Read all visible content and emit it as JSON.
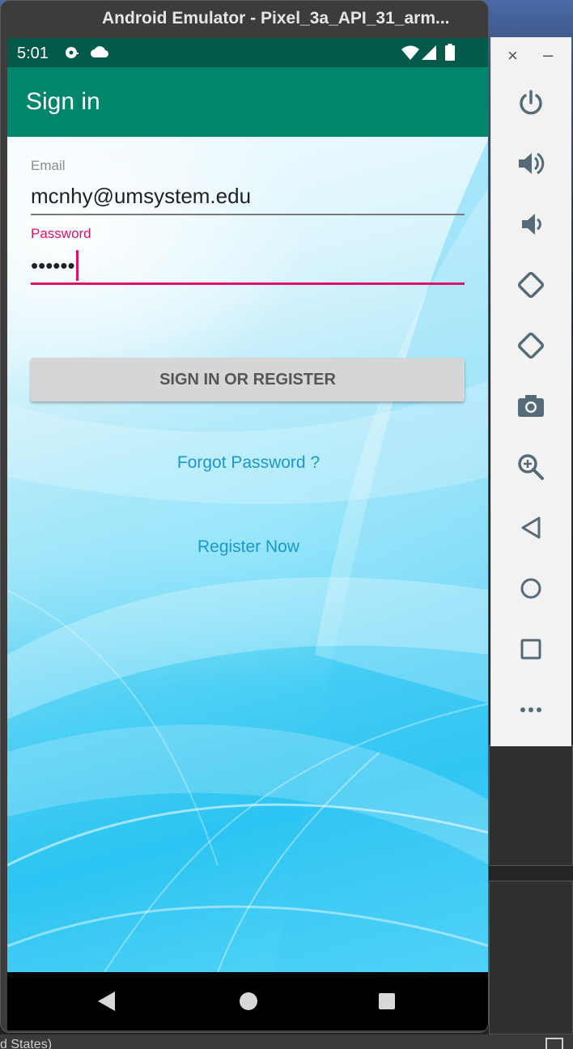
{
  "emulator": {
    "title": "Android Emulator - Pixel_3a_API_31_arm..."
  },
  "statusbar": {
    "time": "5:01"
  },
  "app": {
    "title": "Sign in"
  },
  "form": {
    "email_label": "Email",
    "email_value": "mcnhy@umsystem.edu",
    "password_label": "Password",
    "password_value": "••••••",
    "submit_label": "SIGN IN OR REGISTER",
    "forgot_label": "Forgot Password ?",
    "register_label": "Register Now"
  },
  "toolbar": {
    "close_label": "×",
    "minimize_label": "–",
    "buttons": [
      {
        "icon": "power-icon"
      },
      {
        "icon": "volume-up-icon"
      },
      {
        "icon": "volume-down-icon"
      },
      {
        "icon": "rotate-left-icon"
      },
      {
        "icon": "rotate-right-icon"
      },
      {
        "icon": "camera-icon"
      },
      {
        "icon": "zoom-icon"
      },
      {
        "icon": "back-icon"
      },
      {
        "icon": "home-icon"
      },
      {
        "icon": "overview-icon"
      },
      {
        "icon": "more-icon"
      }
    ]
  },
  "background": {
    "bottom_text": "d States)"
  },
  "colors": {
    "appbar": "#00866d",
    "statusbar": "#035a4a",
    "accent": "#e0106b",
    "link": "#1a98c9"
  }
}
